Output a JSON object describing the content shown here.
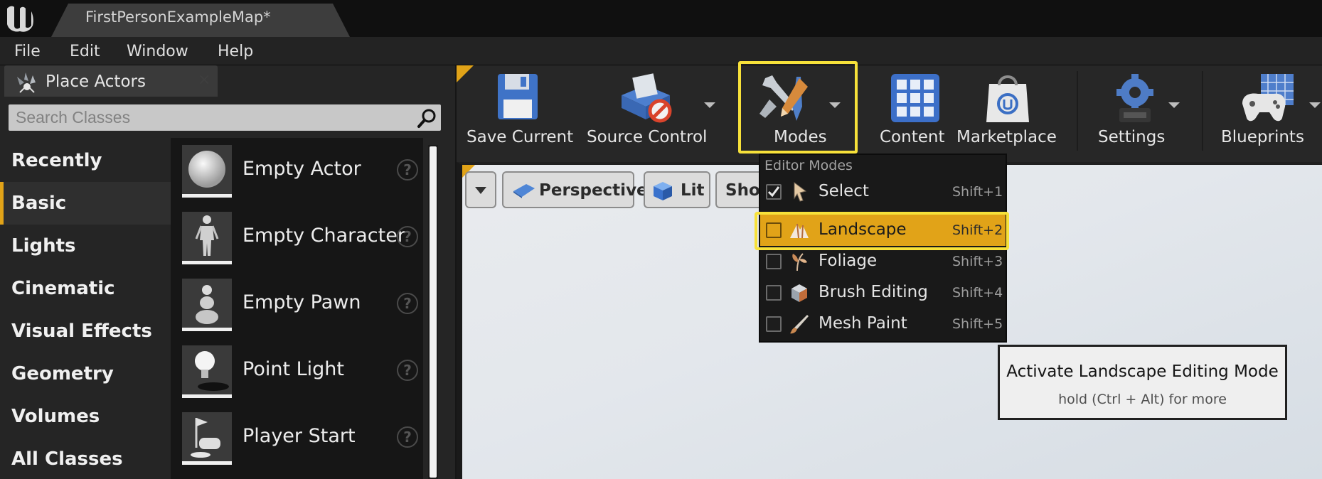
{
  "document_tab": {
    "title": "FirstPersonExampleMap*"
  },
  "menubar": {
    "items": [
      "File",
      "Edit",
      "Window",
      "Help"
    ]
  },
  "place_actors": {
    "tab_label": "Place Actors",
    "close_glyph": "×",
    "search_placeholder": "Search Classes",
    "categories": [
      "Recently Placed",
      "Basic",
      "Lights",
      "Cinematic",
      "Visual Effects",
      "Geometry",
      "Volumes",
      "All Classes"
    ],
    "active_category": "Basic",
    "actors": [
      {
        "label": "Empty Actor",
        "icon": "sphere-icon"
      },
      {
        "label": "Empty Character",
        "icon": "character-icon"
      },
      {
        "label": "Empty Pawn",
        "icon": "pawn-icon"
      },
      {
        "label": "Point Light",
        "icon": "light-bulb-icon"
      },
      {
        "label": "Player Start",
        "icon": "player-start-icon"
      }
    ],
    "help_glyph": "?"
  },
  "toolbar": {
    "save_current": "Save Current",
    "source_control": "Source Control",
    "modes": "Modes",
    "content": "Content",
    "marketplace": "Marketplace",
    "settings": "Settings",
    "blueprints": "Blueprints"
  },
  "viewport": {
    "perspective": "Perspective",
    "lit": "Lit",
    "show": "Show"
  },
  "editor_modes": {
    "header": "Editor Modes",
    "items": [
      {
        "label": "Select",
        "shortcut": "Shift+1",
        "checked": true
      },
      {
        "label": "Landscape",
        "shortcut": "Shift+2",
        "checked": false
      },
      {
        "label": "Foliage",
        "shortcut": "Shift+3",
        "checked": false
      },
      {
        "label": "Brush Editing",
        "shortcut": "Shift+4",
        "checked": false
      },
      {
        "label": "Mesh Paint",
        "shortcut": "Shift+5",
        "checked": false
      }
    ],
    "highlighted": "Landscape"
  },
  "tooltip": {
    "title": "Activate Landscape Editing Mode",
    "subtitle": "hold (Ctrl + Alt) for more"
  },
  "colors": {
    "accent": "#e1a318",
    "highlight_outline": "#f7e13a",
    "panel_bg": "#252525",
    "toolbar_bg": "#272727"
  }
}
